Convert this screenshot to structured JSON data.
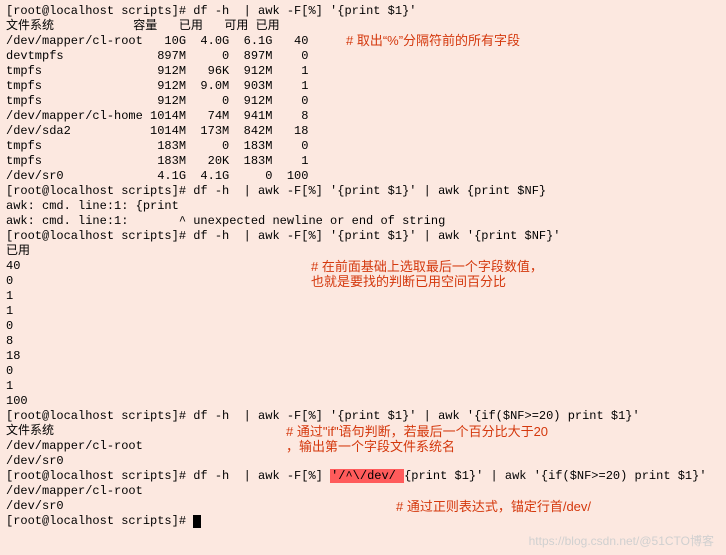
{
  "prompt_host": "[root@localhost scripts]# ",
  "cmd1": "df -h  | awk -F[%] '{print $1}'",
  "df_header": "文件系统           容量   已用   可用 已用",
  "df_rows": [
    "/dev/mapper/cl-root   10G  4.0G  6.1G   40",
    "devtmpfs             897M     0  897M    0",
    "tmpfs                912M   96K  912M    1",
    "tmpfs                912M  9.0M  903M    1",
    "tmpfs                912M     0  912M    0",
    "/dev/mapper/cl-home 1014M   74M  941M    8",
    "/dev/sda2           1014M  173M  842M   18",
    "tmpfs                183M     0  183M    0",
    "tmpfs                183M   20K  183M    1",
    "/dev/sr0             4.1G  4.1G     0  100"
  ],
  "cmd2": "df -h  | awk -F[%] '{print $1}' | awk {print $NF}",
  "err1": "awk: cmd. line:1: {print",
  "err2": "awk: cmd. line:1:       ^ unexpected newline or end of string",
  "cmd3": "df -h  | awk -F[%] '{print $1}' | awk '{print $NF}'",
  "out3_header": "已用",
  "out3_vals": [
    "40",
    "0",
    "1",
    "1",
    "0",
    "8",
    "18",
    "0",
    "1",
    "100"
  ],
  "cmd4": "df -h  | awk -F[%] '{print $1}' | awk '{if($NF>=20) print $1}'",
  "out4_header": "文件系统",
  "out4": [
    "/dev/mapper/cl-root",
    "/dev/sr0"
  ],
  "cmd5_a": "df -h  | awk -F[%] ",
  "cmd5_hl": "'/^\\/dev/ ",
  "cmd5_b": "{print $1}' | awk '{if($NF>=20) print $1}'",
  "out5": [
    "/dev/mapper/cl-root",
    "/dev/sr0"
  ],
  "note1": "# 取出“%”分隔符前的所有字段",
  "note2a": "# 在前面基础上选取最后一个字段数值，",
  "note2b": "也就是要找的判断已用空间百分比",
  "note3a": "# 通过\"if\"语句判断，若最后一个百分比大于20",
  "note3b": "，输出第一个字段文件系统名",
  "note4": "# 通过正则表达式，锚定行首/dev/",
  "watermark": "https://blog.csdn.net/@51CTO博客"
}
